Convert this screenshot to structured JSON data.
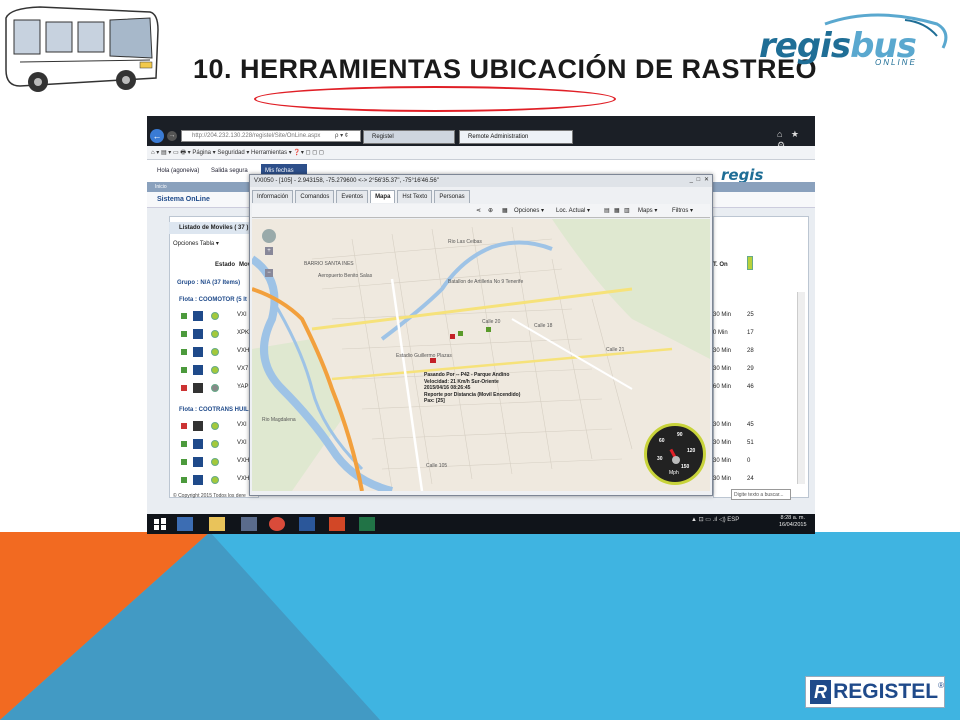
{
  "slide": {
    "title": "10. HERRAMIENTAS UBICACIÓN DE RASTREO",
    "logo": {
      "word_main": "regis",
      "word_accent": "bus",
      "tagline": "ONLINE"
    },
    "footer_logo": {
      "mark": "R",
      "text": "REGISTEL",
      "registered": "®"
    },
    "colors": {
      "orange": "#f26a21",
      "blue": "#3fb4e1",
      "navy": "#1f4a8a"
    }
  },
  "browser": {
    "address": "http://204.232.130.228/registel/Site/OnLine.aspx",
    "address_tools": "ρ ▾ ¢",
    "tabs": [
      {
        "label": "Registel"
      },
      {
        "label": "Remote Administration"
      }
    ],
    "corner_icons": "⌂ ★ ⚙",
    "command_bar": "⌂ ▾  ▤ ▾  ▭  🖶 ▾  Página ▾   Seguridad ▾   Herramientas ▾   ❓▾   ◻   ◻   ◻"
  },
  "app": {
    "user": "Hola (agoneiva)",
    "logout": "Salida segura",
    "date_button": "Mis fechas",
    "nav": "Inicio",
    "section_title": "Sistema OnLine",
    "logo_word": "regis",
    "list_title": "Listado de Moviles ( 37 )",
    "options_table": "Opciones Tabla ▾",
    "col_estado": "Estado",
    "col_mov": "Mov",
    "group": "Grupo : N/A (37 Items)",
    "flota1": "Flota : COOMOTOR (5 It",
    "flota2": "Flota : COOTRANS HUIL",
    "rows_fleet1": [
      {
        "plate": "VXI"
      },
      {
        "plate": "XPK"
      },
      {
        "plate": "VXH"
      },
      {
        "plate": "VX7"
      },
      {
        "plate": "YAP"
      }
    ],
    "rows_fleet2": [
      {
        "plate": "VXI"
      },
      {
        "plate": "VXI"
      },
      {
        "plate": "VXH"
      },
      {
        "plate": "VXH"
      }
    ],
    "col_t": "T. On",
    "right_rows": [
      {
        "time": "30 Min",
        "value": "25"
      },
      {
        "time": "0 Min",
        "value": "17"
      },
      {
        "time": "30 Min",
        "value": "28"
      },
      {
        "time": "30 Min",
        "value": "29"
      },
      {
        "time": "60 Min",
        "value": "46"
      },
      {
        "time": "30 Min",
        "value": "45"
      },
      {
        "time": "30 Min",
        "value": "51"
      },
      {
        "time": "30 Min",
        "value": "0"
      },
      {
        "time": "30 Min",
        "value": "24"
      }
    ],
    "copyright": "© Copyright 2015 Todos los dere",
    "search_placeholder": "Digite texto a buscar..."
  },
  "popup": {
    "title": "VXI050 - [105] - 2.943158, -75.279600 <-> 2°56'35.37\", -75°16'46.56\"",
    "controls": "_ □ ✕",
    "tabs": [
      "Información",
      "Comandos",
      "Eventos",
      "Mapa",
      "Hst Texto",
      "Personas"
    ],
    "active_tab": "Mapa",
    "toolbar": {
      "opciones": "Opciones ▾",
      "loc_actual": "Loc. Actual ▾",
      "maps": "Maps ▾",
      "filtros": "Filtros ▾"
    },
    "map_labels": {
      "aeropuerto": "Aeropuerto Benito Salas",
      "batallon": "Batallon de Artilleria No 9 Tenerife",
      "barrio": "BARRIO SANTA INES",
      "estadio": "Estadio Guillermo Plazas",
      "rio_mag": "Rio Magdalena",
      "rio_las_ceibas": "Rio Las Ceibas",
      "calle20": "Calle 20",
      "calle18": "Calle 18",
      "calle21": "Calle 21",
      "calle105": "Calle 105"
    },
    "tooltip": [
      "Pasando Por -- P42 - Parque Andino",
      "Velocidad: 21 Km/h Sur-Oriente",
      "2015/04/16 08:26:45",
      "Reporte por Distancia (Movil Encendido)",
      "Pax: [25]"
    ],
    "gauge": {
      "ticks": [
        "30",
        "60",
        "90",
        "120",
        "150"
      ],
      "unit": "Mph",
      "speed": 21
    }
  },
  "taskbar": {
    "tray": "▲  ⊡  ▭  .ıl  ◁)  ESP",
    "time": "8:28 a. m.",
    "date": "16/04/2015"
  }
}
